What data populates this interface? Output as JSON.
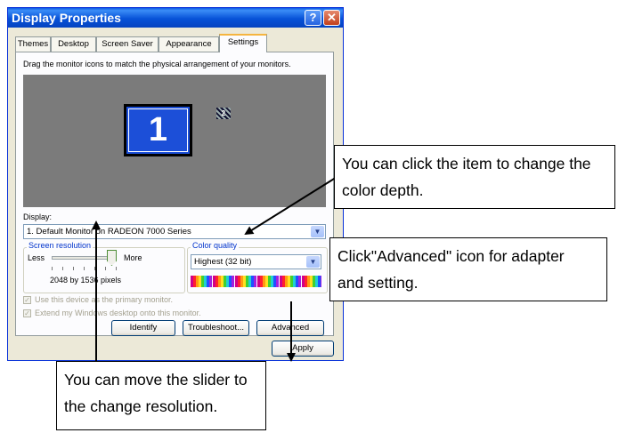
{
  "window": {
    "title": "Display Properties",
    "help_glyph": "?",
    "close_glyph": "✕"
  },
  "tabs": [
    {
      "label": "Themes"
    },
    {
      "label": "Desktop"
    },
    {
      "label": "Screen Saver"
    },
    {
      "label": "Appearance"
    },
    {
      "label": "Settings"
    }
  ],
  "settings": {
    "instruction": "Drag the monitor icons to match the physical arrangement of your monitors.",
    "monitor_primary_number": "1",
    "monitor_secondary_number": "2",
    "display_label": "Display:",
    "display_value": "1. Default Monitor on RADEON 7000 Series",
    "screen_resolution_label": "Screen resolution",
    "less_label": "Less",
    "more_label": "More",
    "resolution_value": "2048 by 1536 pixels",
    "slider_level": 1.0,
    "color_quality_label": "Color quality",
    "color_quality_value": "Highest (32 bit)",
    "primary_monitor_checkbox": "Use this device as the primary monitor.",
    "extend_desktop_checkbox": "Extend my Windows desktop onto this monitor.",
    "identify_button": "Identify",
    "troubleshoot_button": "Troubleshoot...",
    "advanced_button": "Advanced",
    "apply_button": "Apply",
    "dropdown_glyph": "▼"
  },
  "callouts": {
    "color_depth": [
      "You can click the item to change the",
      "color depth."
    ],
    "advanced": [
      "Click\"Advanced\" icon for adapter",
      "and setting."
    ],
    "slider": [
      "You can move the slider to",
      "the change resolution."
    ]
  },
  "colors": {
    "title_bar": "#0752d8",
    "monitor_fill": "#1c4fd8",
    "desktop_preview": "#7b7b7b",
    "window_background": "#ece9d8"
  }
}
